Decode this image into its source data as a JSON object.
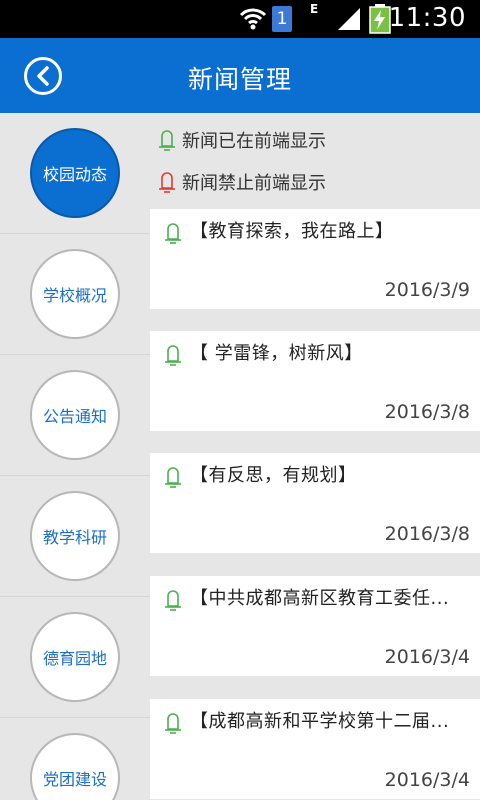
{
  "status_bar": {
    "time": "11:30",
    "sim_label": "1",
    "network_label": "E",
    "icons": [
      "wifi-icon",
      "sim-icon",
      "signal-icon",
      "battery-charging-icon"
    ]
  },
  "header": {
    "title": "新闻管理",
    "back_icon": "back-arrow-icon",
    "color": "#0a6fd0"
  },
  "sidebar": {
    "items": [
      {
        "label": "校园动态",
        "active": true
      },
      {
        "label": "学校概况",
        "active": false
      },
      {
        "label": "公告通知",
        "active": false
      },
      {
        "label": "教学科研",
        "active": false
      },
      {
        "label": "德育园地",
        "active": false
      },
      {
        "label": "党团建设",
        "active": false
      }
    ]
  },
  "legend": {
    "shown": {
      "label": "新闻已在前端显示",
      "color": "#4caf50",
      "icon": "bell-green-icon"
    },
    "hidden": {
      "label": "新闻禁止前端显示",
      "color": "#e53935",
      "icon": "bell-red-icon"
    }
  },
  "news": [
    {
      "title": "【教育探索，我在路上】",
      "date": "2016/3/9",
      "status": "shown"
    },
    {
      "title": "【 学雷锋，树新风】",
      "date": "2016/3/8",
      "status": "shown"
    },
    {
      "title": "【有反思，有规划】",
      "date": "2016/3/8",
      "status": "shown"
    },
    {
      "title": "【中共成都高新区教育工委任...",
      "date": "2016/3/4",
      "status": "shown"
    },
    {
      "title": "【成都高新和平学校第十二届...",
      "date": "2016/3/4",
      "status": "shown"
    }
  ]
}
